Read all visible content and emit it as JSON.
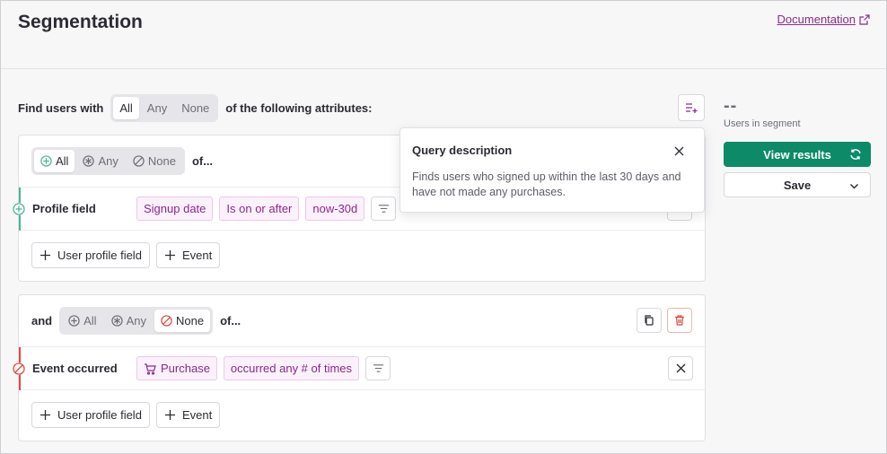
{
  "header": {
    "title": "Segmentation",
    "doc_link": "Documentation"
  },
  "find_row": {
    "prefix": "Find users with",
    "options": [
      "All",
      "Any",
      "None"
    ],
    "suffix": "of the following attributes:"
  },
  "group1": {
    "options": [
      "All",
      "Any",
      "None"
    ],
    "suffix": "of...",
    "condition": {
      "label": "Profile field",
      "chips": [
        "Signup date",
        "Is on or after",
        "now-30d"
      ]
    },
    "add_buttons": [
      "User profile field",
      "Event"
    ]
  },
  "group2": {
    "prefix": "and",
    "options": [
      "All",
      "Any",
      "None"
    ],
    "suffix": "of...",
    "condition": {
      "label": "Event occurred",
      "chips": [
        "Purchase",
        "occurred any # of times"
      ]
    },
    "add_buttons": [
      "User profile field",
      "Event"
    ]
  },
  "popover": {
    "title": "Query description",
    "text": "Finds users who signed up within the last 30 days and have not made any purchases."
  },
  "side": {
    "count": "--",
    "count_label": "Users in segment",
    "view_results": "View results",
    "save": "Save"
  },
  "colors": {
    "accent": "#0d8a68",
    "chip": "#8a2a8a",
    "rail_green": "#4fb38f",
    "rail_red": "#e0483d"
  }
}
